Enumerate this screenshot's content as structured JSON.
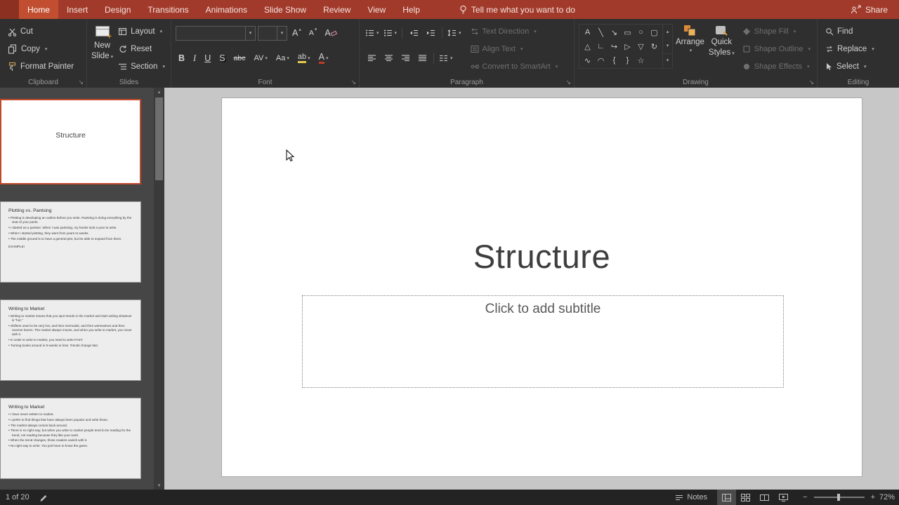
{
  "icons": {
    "caret": "▾",
    "caret_up": "▴",
    "launcher": "↘",
    "scroll_up": "▴",
    "scroll_down": "▾"
  },
  "menubar": {
    "tabs": [
      "Home",
      "Insert",
      "Design",
      "Transitions",
      "Animations",
      "Slide Show",
      "Review",
      "View",
      "Help"
    ],
    "tell_me": "Tell me what you want to do",
    "share": "Share"
  },
  "ribbon": {
    "clipboard": {
      "label": "Clipboard",
      "cut": "Cut",
      "copy": "Copy",
      "format_painter": "Format Painter"
    },
    "slides": {
      "label": "Slides",
      "new_slide_line1": "New",
      "new_slide_line2": "Slide",
      "layout": "Layout",
      "reset": "Reset",
      "section": "Section"
    },
    "font": {
      "label": "Font",
      "name_value": "",
      "size_value": "",
      "grow": "A",
      "shrink": "A",
      "clear": "A",
      "bold": "B",
      "italic": "I",
      "underline": "U",
      "shadow": "S",
      "strike": "abc",
      "spacing": "AV",
      "case": "Aa",
      "highlight": "ab",
      "color": "A"
    },
    "paragraph": {
      "label": "Paragraph",
      "text_direction": "Text Direction",
      "align_text": "Align Text",
      "smartart": "Convert to SmartArt"
    },
    "drawing": {
      "label": "Drawing",
      "arrange": "Arrange",
      "quick_line1": "Quick",
      "quick_line2": "Styles",
      "shape_fill": "Shape Fill",
      "shape_outline": "Shape Outline",
      "shape_effects": "Shape Effects",
      "shapes": [
        "A",
        "╲",
        "↘",
        "▭",
        "○",
        "▢",
        "△",
        "∟",
        "↪",
        "▷",
        "▽",
        "↻",
        "∿",
        "◠",
        "{",
        "}",
        "☆"
      ]
    },
    "editing": {
      "label": "Editing",
      "find": "Find",
      "replace": "Replace",
      "select": "Select"
    }
  },
  "panel": {
    "slides": [
      {
        "title": "Structure"
      },
      {
        "title": "Plotting vs. Pantsing",
        "bullets": [
          "Plotting is developing an outline before you write. Pantsing is doing everything by the seat of your pants.",
          "I started as a pantser. When I was pantsing, my books took a year to write.",
          "When I started plotting, they went from years to weeks.",
          "The middle ground is to have a general plot, but be able to expand from there."
        ],
        "tagline": "EXAMPLE!"
      },
      {
        "title": "Writing to Market",
        "bullets": [
          "Writing to market means that you spot trends in the market and start writing whatever is \"hot.\"",
          "Shifters used to be very hot, and then mermaids, and then werewolves and then reverse harem. The market always moves, and when you write to market, you move with it.",
          "In order to write to market, you need to write FAST.",
          "Turning books around in 8 weeks or less. Trends change fast."
        ]
      },
      {
        "title": "Writing to Market",
        "bullets": [
          "I have never written to market.",
          "I prefer to find things that have always been popular and write those.",
          "The market always comes back around.",
          "There is no right way, but when you write to market people tend to be reading for the trend, not reading because they like your work.",
          "When the trend changes, those readers vanish with it.",
          "No right way to write. You just have to know the game."
        ]
      }
    ]
  },
  "slide": {
    "title": "Structure",
    "subtitle": "Click to add subtitle"
  },
  "statusbar": {
    "indicator": "1 of 20",
    "notes": "Notes",
    "zoom": "72%",
    "zoom_out": "−",
    "zoom_in": "+"
  }
}
